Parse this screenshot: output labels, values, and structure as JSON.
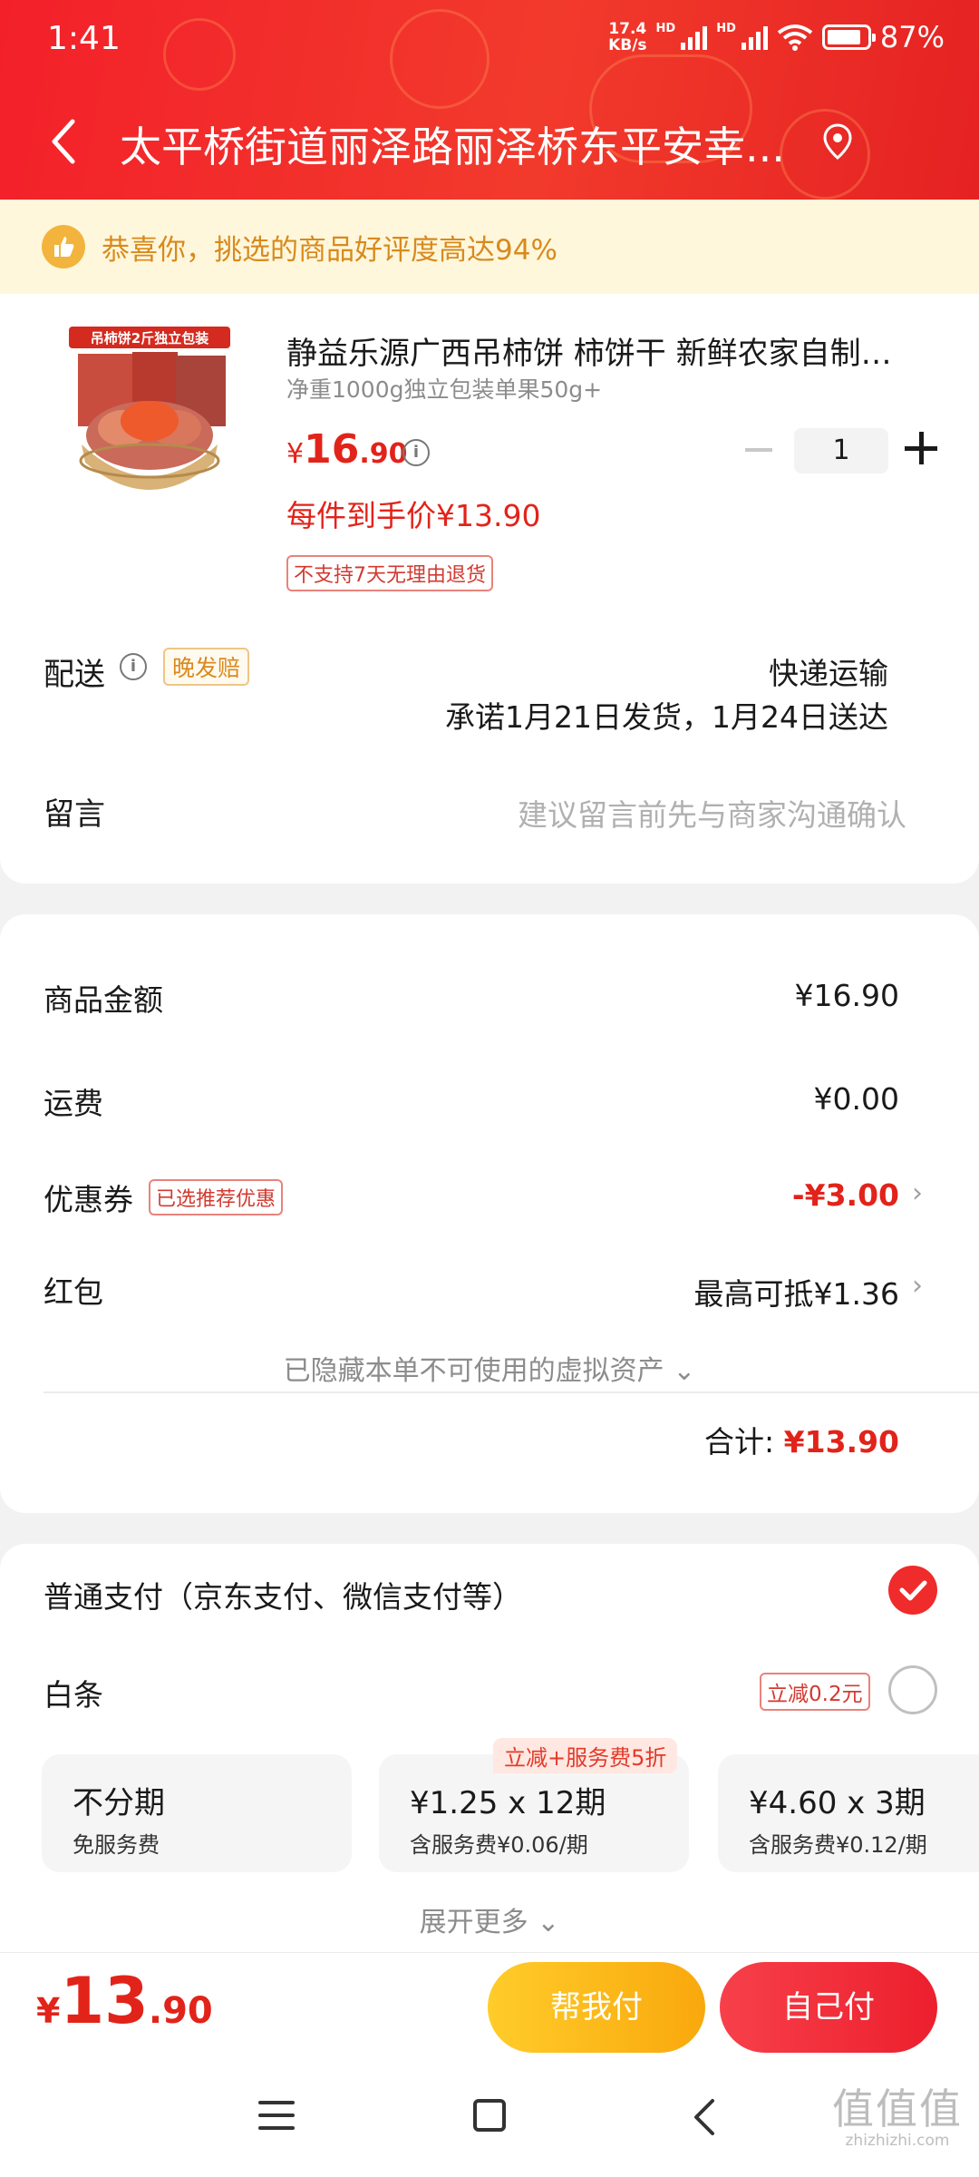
{
  "status_bar": {
    "time": "1:41",
    "net_speed_value": "17.4",
    "net_speed_unit": "KB/s",
    "hd1": "HD",
    "hd2": "HD",
    "battery": "87%"
  },
  "header": {
    "address": "太平桥街道丽泽路丽泽桥东平安幸..."
  },
  "banner": {
    "text": "恭喜你，挑选的商品好评度高达94%"
  },
  "product": {
    "image_label": "吊柿饼2斤独立包装",
    "title": "静益乐源广西吊柿饼 柿饼干 新鲜农家自制吊...",
    "spec": "净重1000g独立包装单果50g+",
    "price_currency": "¥",
    "price_int": "16",
    "price_dec": ".90",
    "quantity": "1",
    "unit_price": "每件到手价¥13.90",
    "no_return_tag": "不支持7天无理由退货"
  },
  "delivery": {
    "label": "配送",
    "badge": "晚发赔",
    "type": "快递运输",
    "promise": "承诺1月21日发货，1月24日送达"
  },
  "message": {
    "label": "留言",
    "placeholder": "建议留言前先与商家沟通确认"
  },
  "summary": {
    "goods_label": "商品金额",
    "goods_value": "¥16.90",
    "shipping_label": "运费",
    "shipping_value": "¥0.00",
    "coupon_label": "优惠券",
    "coupon_badge": "已选推荐优惠",
    "coupon_value": "-¥3.00",
    "redpacket_label": "红包",
    "redpacket_value": "最高可抵¥1.36",
    "hidden_note": "已隐藏本单不可使用的虚拟资产",
    "total_label": "合计:",
    "total_value": "¥13.90"
  },
  "payment": {
    "normal_label": "普通支付（京东支付、微信支付等）",
    "baitiao_label": "白条",
    "baitiao_badge": "立减0.2元",
    "promo_tag": "立减+服务费5折",
    "plans": [
      {
        "main": "不分期",
        "sub": "免服务费"
      },
      {
        "main": "¥1.25 x 12期",
        "sub": "含服务费¥0.06/期"
      },
      {
        "main": "¥4.60 x 3期",
        "sub": "含服务费¥0.12/期"
      }
    ],
    "expand": "展开更多"
  },
  "bottom": {
    "currency": "¥",
    "int": "13",
    "dec": ".90",
    "help_pay": "帮我付",
    "self_pay": "自己付"
  },
  "watermark": {
    "big": "值值值",
    "small": "zhizhizhi.com"
  },
  "colors": {
    "accent_red": "#e2231a",
    "header_red": "#f3202a",
    "help_yellow": "#f9a80c"
  }
}
